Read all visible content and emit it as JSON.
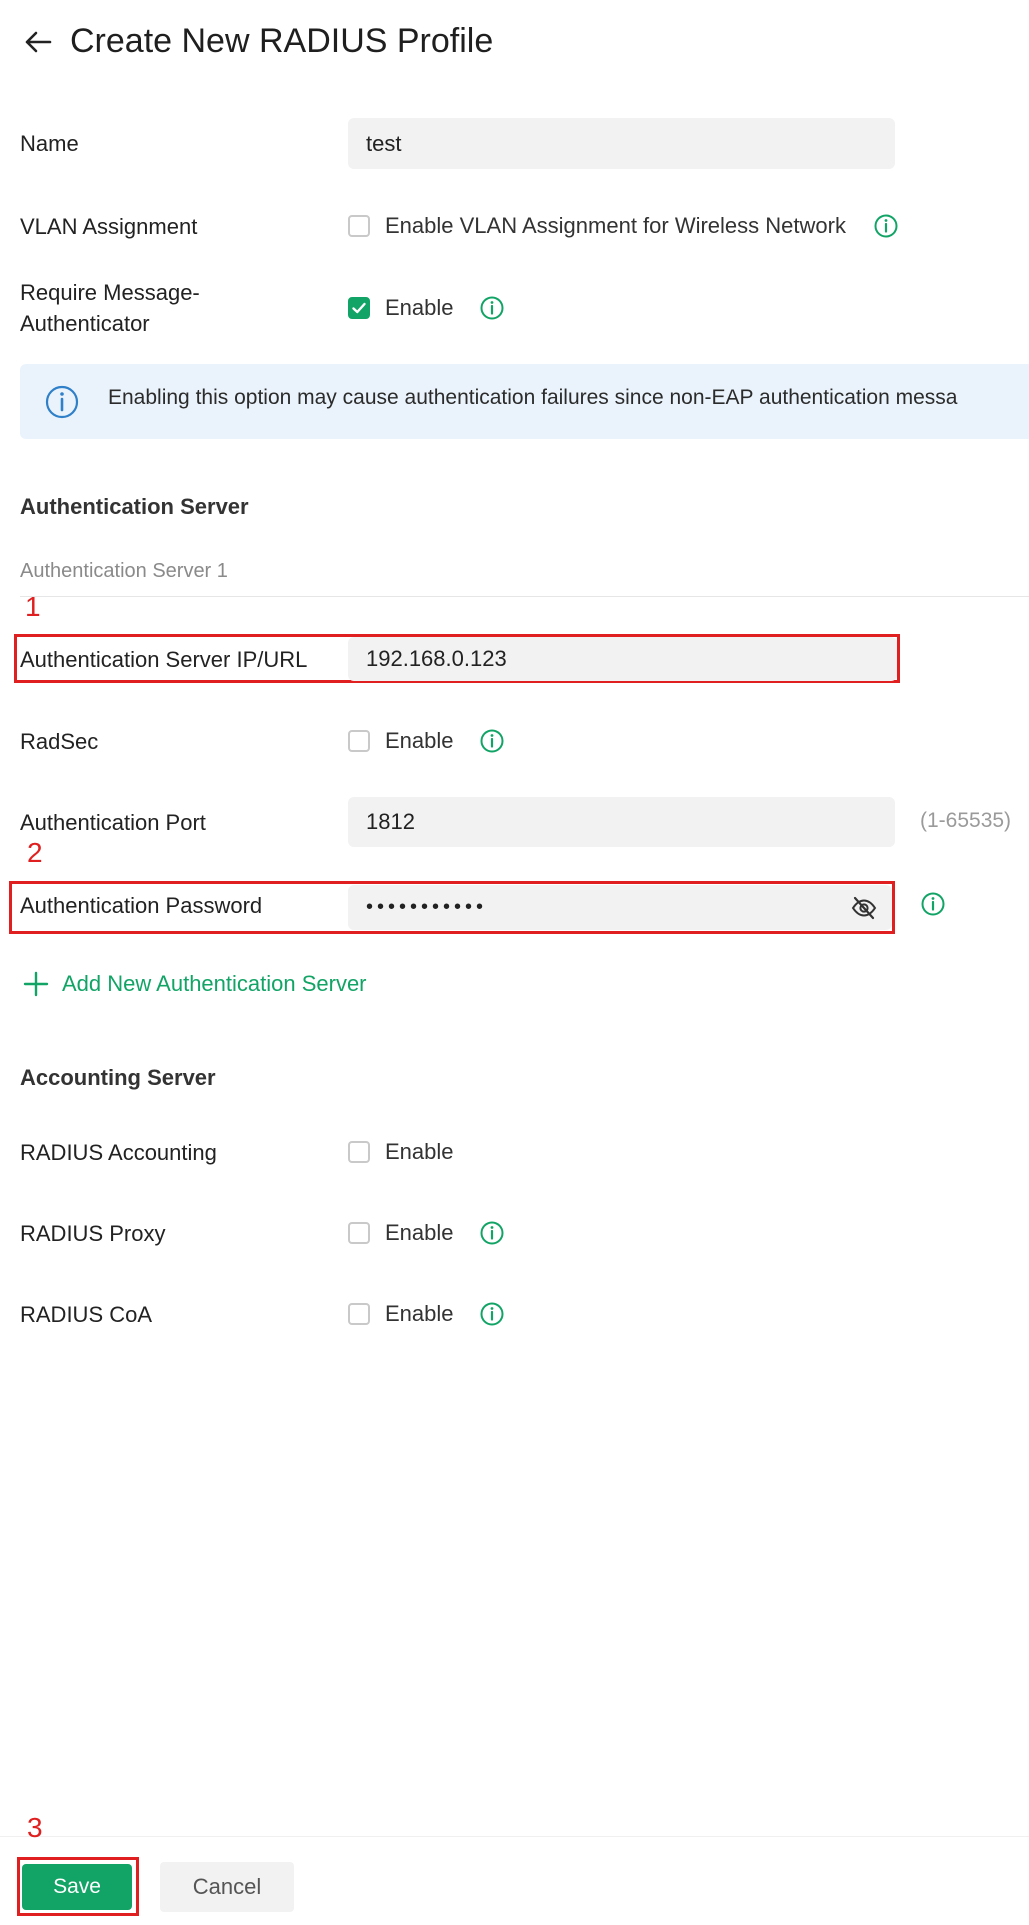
{
  "header": {
    "title": "Create New RADIUS Profile"
  },
  "form": {
    "name": {
      "label": "Name",
      "value": "test"
    },
    "vlan": {
      "label": "VLAN Assignment",
      "checkbox_label": "Enable VLAN Assignment for Wireless Network",
      "checked": false
    },
    "require_msg_auth": {
      "label_line1": "Require Message-",
      "label_line2": "Authenticator",
      "checkbox_label": "Enable",
      "checked": true
    },
    "notice": {
      "text": "Enabling this option may cause authentication failures since non-EAP authentication messa"
    }
  },
  "auth_server": {
    "heading": "Authentication Server",
    "sub_heading": "Authentication Server 1",
    "ip_url": {
      "label": "Authentication Server IP/URL",
      "value": "192.168.0.123"
    },
    "radsec": {
      "label": "RadSec",
      "checkbox_label": "Enable",
      "checked": false
    },
    "port": {
      "label": "Authentication Port",
      "value": "1812",
      "hint": "(1-65535)"
    },
    "password": {
      "label": "Authentication Password",
      "value": "•••••••••••"
    },
    "add_label": "Add New Authentication Server"
  },
  "accounting_server": {
    "heading": "Accounting Server",
    "radius_accounting": {
      "label": "RADIUS Accounting",
      "checkbox_label": "Enable",
      "checked": false
    },
    "radius_proxy": {
      "label": "RADIUS Proxy",
      "checkbox_label": "Enable",
      "checked": false
    },
    "radius_coa": {
      "label": "RADIUS CoA",
      "checkbox_label": "Enable",
      "checked": false
    }
  },
  "annotations": {
    "step1": "1",
    "step2": "2",
    "step3": "3"
  },
  "footer": {
    "save_label": "Save",
    "cancel_label": "Cancel"
  },
  "icons": {
    "back": "arrow-left-icon",
    "info": "info-circle-icon",
    "eye": "eye-off-icon",
    "plus": "plus-icon",
    "check": "check-icon"
  },
  "colors": {
    "accent": "#12a466",
    "annotation": "#e02020",
    "notice_bg": "#eaf3fb",
    "notice_icon": "#2f80c9"
  }
}
